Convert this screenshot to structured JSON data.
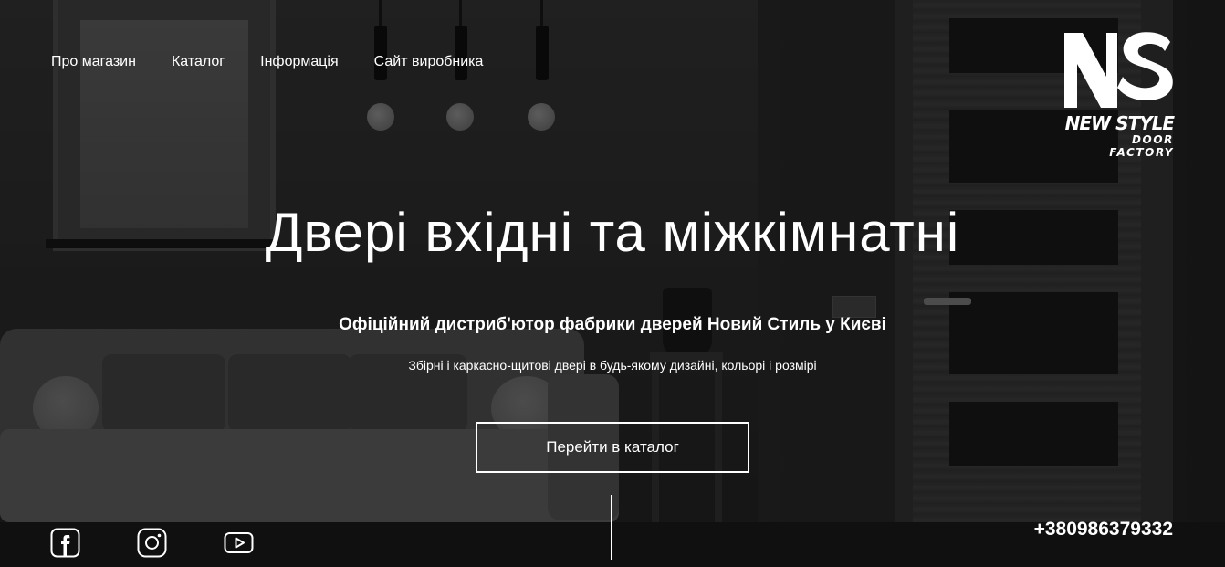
{
  "nav": {
    "items": [
      {
        "label": "Про магазин"
      },
      {
        "label": "Каталог"
      },
      {
        "label": "Інформація"
      },
      {
        "label": "Сайт виробника"
      }
    ]
  },
  "logo": {
    "brand": "NEW STYLE",
    "sub": "DOOR FACTORY"
  },
  "hero": {
    "title": "Двері вхідні та міжкімнатні",
    "subtitle": "Офіційний дистриб'ютор фабрики дверей Новий Стиль у Києві",
    "description": "Збірні і каркасно-щитові двері в будь-якому дизайні, кольорі і розмірі",
    "cta_label": "Перейти в каталог"
  },
  "socials": [
    {
      "icon": "facebook-icon"
    },
    {
      "icon": "instagram-icon"
    },
    {
      "icon": "youtube-icon"
    }
  ],
  "contact": {
    "phone": "+380986379332"
  },
  "colors": {
    "text": "#ffffff",
    "overlay": "#000000"
  }
}
